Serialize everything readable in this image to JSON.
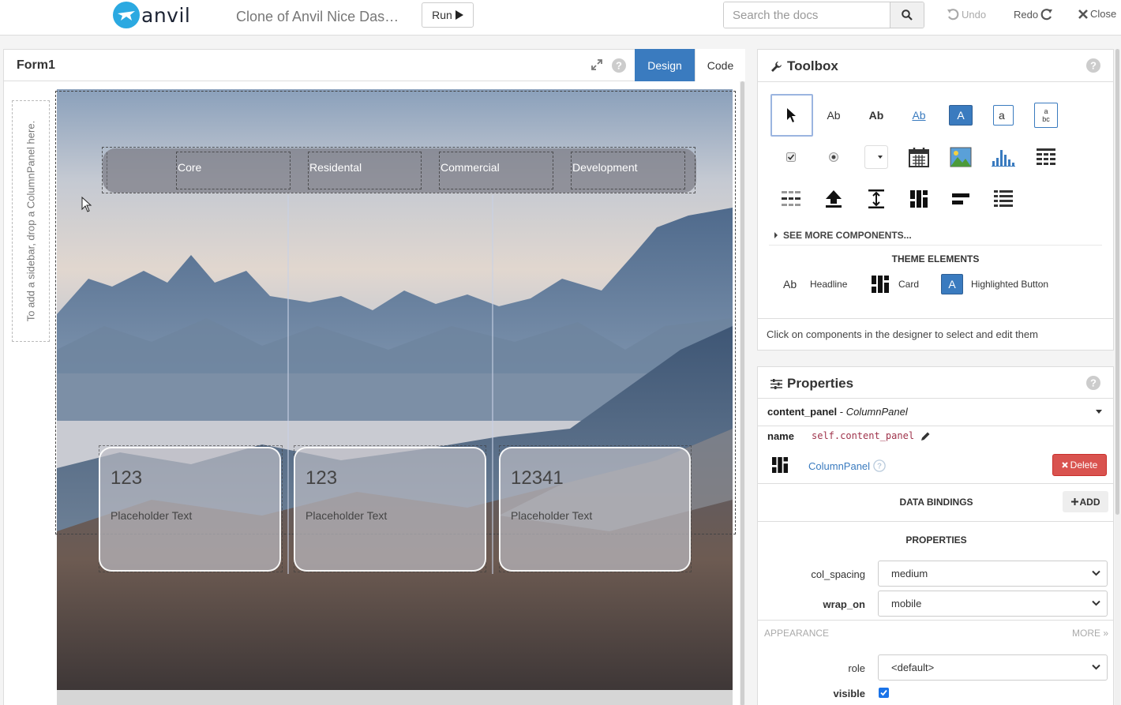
{
  "app": {
    "logo_text": "anvil",
    "title": "Clone of Anvil Nice Das…",
    "run_label": "Run",
    "search_placeholder": "Search the docs",
    "undo_label": "Undo",
    "redo_label": "Redo",
    "close_label": "Close"
  },
  "designer": {
    "form_name": "Form1",
    "tabs": {
      "design": "Design",
      "code": "Code"
    },
    "sidebar_hint": "To add a sidebar, drop a ColumnPanel here.",
    "nav_items": [
      "Core",
      "Residental",
      "Commercial",
      "Development"
    ],
    "cards": [
      {
        "number": "123",
        "text": "Placeholder Text"
      },
      {
        "number": "123",
        "text": "Placeholder Text"
      },
      {
        "number": "12341",
        "text": "Placeholder Text"
      }
    ]
  },
  "toolbox": {
    "title": "Toolbox",
    "tools": [
      "pointer-icon",
      "label-icon",
      "headline-icon",
      "link-icon",
      "button-icon",
      "textbox-icon",
      "textarea-icon",
      "checkbox-icon",
      "radio-icon",
      "dropdown-icon",
      "datepicker-icon",
      "image-icon",
      "plot-icon",
      "datagrid-icon",
      "repeatingpanel-icon",
      "fileloader-icon",
      "spacer-icon",
      "columnpanel-icon",
      "linearpanel-icon",
      "flowpanel-icon"
    ],
    "text_samples": {
      "label": "Ab",
      "headline": "Ab",
      "link": "Ab",
      "button": "A",
      "textbox": "a",
      "textarea_top": "a",
      "textarea_bottom": "bc"
    },
    "see_more": "SEE MORE COMPONENTS...",
    "theme_title": "THEME ELEMENTS",
    "theme_items": [
      {
        "icon": "Ab",
        "label": "Headline"
      },
      {
        "icon": "card-icon",
        "label": "Card"
      },
      {
        "icon": "A",
        "label": "Highlighted Button"
      }
    ],
    "hint": "Click on components in the designer to select and edit them"
  },
  "properties": {
    "title": "Properties",
    "component_name": "content_panel",
    "separator": " - ",
    "component_type": "ColumnPanel",
    "name_label": "name",
    "name_value": "self.content_panel",
    "type_link": "ColumnPanel",
    "delete_label": "Delete",
    "data_bindings_title": "DATA BINDINGS",
    "add_label": "ADD",
    "properties_title": "PROPERTIES",
    "col_spacing_label": "col_spacing",
    "col_spacing_value": "medium",
    "wrap_on_label": "wrap_on",
    "wrap_on_value": "mobile",
    "appearance_label": "APPEARANCE",
    "more_label": "MORE »",
    "role_label": "role",
    "role_value": "<default>",
    "visible_label": "visible",
    "visible_checked": true
  },
  "colors": {
    "accent": "#3a7bbf",
    "danger": "#d9534f",
    "code": "#a0344c"
  }
}
